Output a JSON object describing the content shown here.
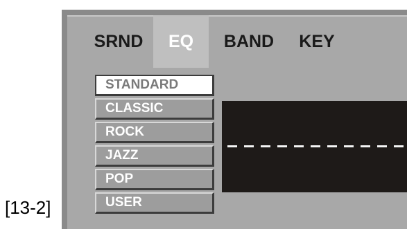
{
  "figure_label": "[13-2]",
  "tabs": [
    {
      "label": "SRND",
      "active": false
    },
    {
      "label": "EQ",
      "active": true
    },
    {
      "label": "BAND",
      "active": false
    },
    {
      "label": "KEY",
      "active": false
    }
  ],
  "eq_presets": [
    {
      "label": "STANDARD",
      "selected": true
    },
    {
      "label": "CLASSIC",
      "selected": false
    },
    {
      "label": "ROCK",
      "selected": false
    },
    {
      "label": "JAZZ",
      "selected": false
    },
    {
      "label": "POP",
      "selected": false
    },
    {
      "label": "USER",
      "selected": false
    }
  ],
  "eq_display": {
    "curve_style": "dashed-flat",
    "background_color": "#1e1a18",
    "curve_color": "#f4f4f4"
  }
}
